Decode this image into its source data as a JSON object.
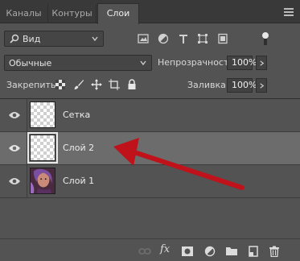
{
  "tabs": [
    {
      "label": "Каналы",
      "active": false
    },
    {
      "label": "Контуры",
      "active": false
    },
    {
      "label": "Слои",
      "active": true
    }
  ],
  "filter": {
    "label": "Вид",
    "icons": [
      "image-filter-icon",
      "adjustment-filter-icon",
      "type-filter-icon",
      "shape-filter-icon",
      "smart-object-filter-icon"
    ]
  },
  "blend": {
    "mode": "Обычные",
    "opacity_label": "Непрозрачность:",
    "opacity_value": "100%"
  },
  "lock": {
    "label": "Закрепить:",
    "fill_label": "Заливка:",
    "fill_value": "100%"
  },
  "layers": [
    {
      "name": "Сетка",
      "selected": false,
      "visible": true,
      "thumb": "transparent"
    },
    {
      "name": "Слой 2",
      "selected": true,
      "visible": true,
      "thumb": "transparent"
    },
    {
      "name": "Слой 1",
      "selected": false,
      "visible": true,
      "thumb": "photo"
    }
  ],
  "bottom_icons": [
    "link-icon",
    "fx-icon",
    "mask-icon",
    "adjustment-layer-icon",
    "folder-icon",
    "new-layer-icon",
    "trash-icon"
  ],
  "bottom_fx_label": "fx",
  "colors": {
    "panel": "#535353",
    "tabbar": "#393939",
    "selected_row": "#6c6c6c",
    "annotation_arrow": "#c0121a"
  }
}
